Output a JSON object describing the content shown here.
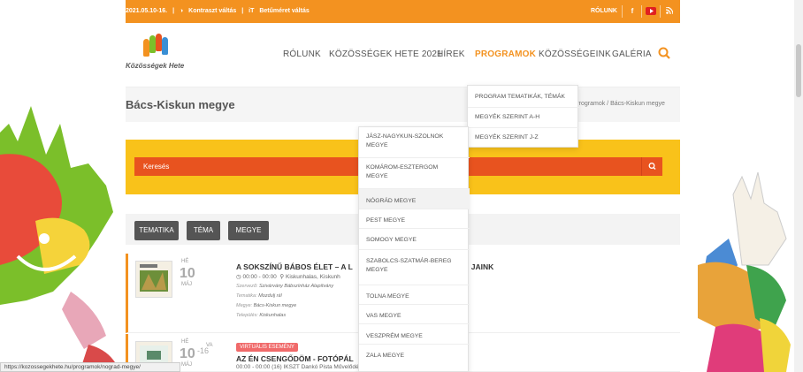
{
  "topbar": {
    "date": "2021.05.10-16.",
    "contrast": "Kontraszt váltás",
    "fontsize": "Betűméret váltás",
    "rolunk": "RÓLUNK",
    "sep1": "|",
    "sep2": "|"
  },
  "logo": {
    "name": "Közösségek Hete"
  },
  "nav": {
    "items": [
      "RÓLUNK",
      "KÖZÖSSÉGEK HETE 2021",
      "HÍREK",
      "PROGRAMOK",
      "KÖZÖSSÉGEINK",
      "GALÉRIA"
    ],
    "active": "PROGRAMOK"
  },
  "page": {
    "title": "Bács-Kiskun megye",
    "breadcrumb": "Programok  /  Bács-Kiskun megye"
  },
  "search": {
    "placeholder": "Keresés"
  },
  "filters": [
    "TEMATIKA",
    "TÉMA",
    "MEGYE"
  ],
  "programs_menu": [
    "PROGRAM TEMATIKÁK, TÉMÁK",
    "MEGYÉK SZERINT A-H",
    "MEGYÉK SZERINT J-Z"
  ],
  "county_menu": [
    {
      "line1": "JÁSZ-NAGYKUN-SZOLNOK",
      "line2": "MEGYE"
    },
    {
      "line1": "KOMÁROM-ESZTERGOM",
      "line2": "MEGYE"
    },
    {
      "line1": "NÓGRÁD MEGYE",
      "line2": ""
    },
    {
      "line1": "PEST MEGYE",
      "line2": ""
    },
    {
      "line1": "SOMOGY MEGYE",
      "line2": ""
    },
    {
      "line1": "SZABOLCS-SZATMÁR-BEREG",
      "line2": "MEGYE"
    },
    {
      "line1": "TOLNA MEGYE",
      "line2": ""
    },
    {
      "line1": "VAS MEGYE",
      "line2": ""
    },
    {
      "line1": "VESZPRÉM MEGYE",
      "line2": ""
    },
    {
      "line1": "ZALA MEGYE",
      "line2": ""
    }
  ],
  "events": [
    {
      "dow": "HÉ",
      "day": "10",
      "month": "MÁJ",
      "title_start": "A SOKSZÍNŰ BÁBOS ÉLET – A L",
      "title_end": "JAINK",
      "time": "00:00 - 00:00",
      "place": "Kiskunhalas, Kiskunh",
      "organizer_label": "Szervező:",
      "organizer": "Szivárvány Bábszínház Alapítvány",
      "theme_label": "Tematika:",
      "theme": "Mozdulj rá!",
      "county_label": "Megye:",
      "county": "Bács-Kiskun megye",
      "settlement_label": "Település:",
      "settlement": "Kiskunhalas"
    },
    {
      "dow": "HÉ",
      "dow2": "VA",
      "day": "10",
      "day2": "16",
      "month": "MÁJ",
      "badge": "VIRTUÁLIS ESEMÉNY",
      "title": "AZ ÉN CSENGŐDÖM - FOTÓPÁL",
      "info": "00:00 - 00:00 (16)   IKSZT Dankó Pista Művelődési Ház, 6222 Csengőd, József A. u. 29."
    }
  ],
  "status_url": "https://kozossegekhete.hu/programok/nograd-megye/",
  "colors": {
    "orange": "#f39220",
    "yellow": "#f9c21a",
    "red": "#e8531f"
  }
}
